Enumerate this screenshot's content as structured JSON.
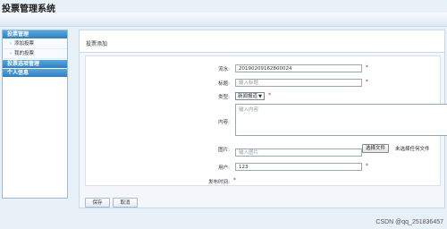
{
  "app": {
    "title": "投票管理系统"
  },
  "sidebar": {
    "sections": [
      {
        "title": "投票管理",
        "items": [
          {
            "label": "添加投票"
          },
          {
            "label": "我的投票"
          }
        ]
      },
      {
        "title": "投票选项管理",
        "items": []
      },
      {
        "title": "个人信息",
        "items": []
      }
    ],
    "bullet": "›"
  },
  "main": {
    "header": "投票添加",
    "form": {
      "serial": {
        "label": "流水:",
        "value": "20190209162800024"
      },
      "title": {
        "label": "标题:",
        "placeholder": "输入标题"
      },
      "type": {
        "label": "类型:",
        "selected": "新闻报道"
      },
      "content": {
        "label": "内容:",
        "placeholder": "输入内容"
      },
      "image": {
        "label": "图片:",
        "placeholder": "输入图片",
        "file_button": "选择文件",
        "file_status": "未选择任何文件"
      },
      "user": {
        "label": "用户:",
        "value": "123"
      },
      "publish_time": {
        "label": "发布时间:"
      },
      "required_mark": "*"
    },
    "buttons": {
      "save": "保存",
      "cancel": "取消"
    }
  },
  "watermark": "CSDN @qq_251836457",
  "colors": {
    "accent": "#2d7fc1",
    "required": "#e02020"
  }
}
